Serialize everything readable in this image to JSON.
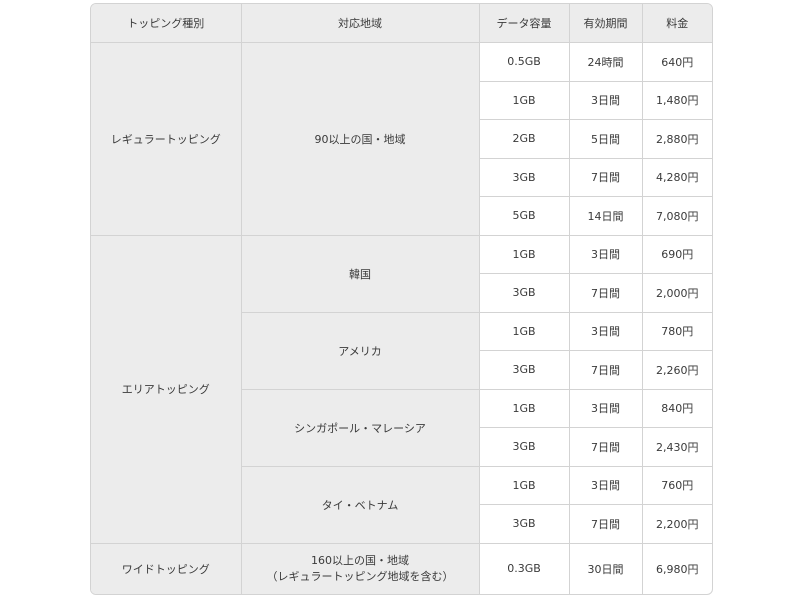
{
  "headers": {
    "type": "トッピング種別",
    "region": "対応地域",
    "data": "データ容量",
    "period": "有効期間",
    "price": "料金"
  },
  "groups": {
    "regular": {
      "type": "レギュラートッピング",
      "region": "90以上の国・地域",
      "rows": [
        {
          "data": "0.5GB",
          "period": "24時間",
          "price": "640円"
        },
        {
          "data": "1GB",
          "period": "3日間",
          "price": "1,480円"
        },
        {
          "data": "2GB",
          "period": "5日間",
          "price": "2,880円"
        },
        {
          "data": "3GB",
          "period": "7日間",
          "price": "4,280円"
        },
        {
          "data": "5GB",
          "period": "14日間",
          "price": "7,080円"
        }
      ]
    },
    "area": {
      "type": "エリアトッピング",
      "regions": [
        {
          "name": "韓国",
          "rows": [
            {
              "data": "1GB",
              "period": "3日間",
              "price": "690円"
            },
            {
              "data": "3GB",
              "period": "7日間",
              "price": "2,000円"
            }
          ]
        },
        {
          "name": "アメリカ",
          "rows": [
            {
              "data": "1GB",
              "period": "3日間",
              "price": "780円"
            },
            {
              "data": "3GB",
              "period": "7日間",
              "price": "2,260円"
            }
          ]
        },
        {
          "name": "シンガポール・マレーシア",
          "rows": [
            {
              "data": "1GB",
              "period": "3日間",
              "price": "840円"
            },
            {
              "data": "3GB",
              "period": "7日間",
              "price": "2,430円"
            }
          ]
        },
        {
          "name": "タイ・ベトナム",
          "rows": [
            {
              "data": "1GB",
              "period": "3日間",
              "price": "760円"
            },
            {
              "data": "3GB",
              "period": "7日間",
              "price": "2,200円"
            }
          ]
        }
      ]
    },
    "wide": {
      "type": "ワイドトッピング",
      "region_line1": "160以上の国・地域",
      "region_line2": "（レギュラートッピング地域を含む）",
      "rows": [
        {
          "data": "0.3GB",
          "period": "30日間",
          "price": "6,980円"
        }
      ]
    }
  }
}
